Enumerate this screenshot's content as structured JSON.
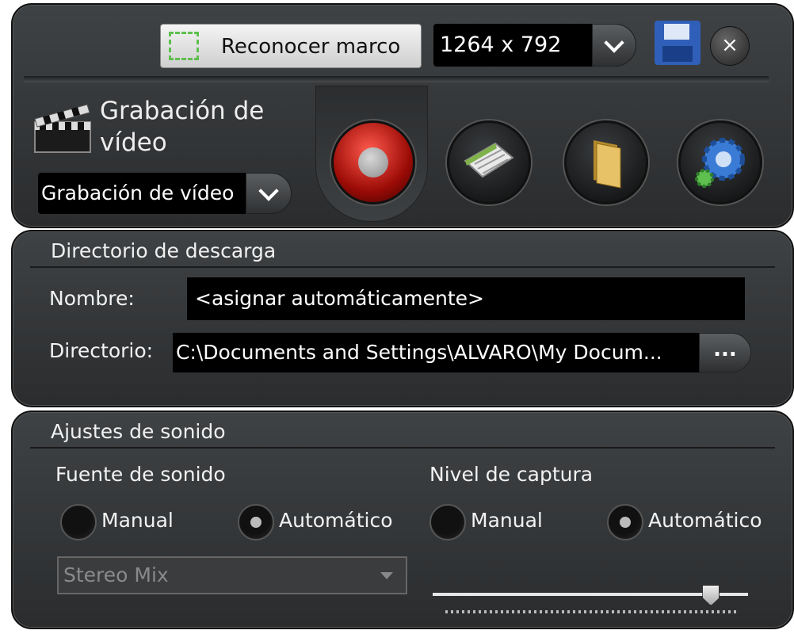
{
  "toolbar": {
    "frame_button_label": "Reconocer marco",
    "resolution_value": "1264 x 792",
    "close_label": "×"
  },
  "mode": {
    "title": "Grabación de vídeo",
    "selected": "Grabación de vídeo"
  },
  "download_dir": {
    "section_title": "Directorio de descarga",
    "name_label": "Nombre:",
    "name_value": "<asignar automáticamente>",
    "dir_label": "Directorio:",
    "dir_value": "C:\\Documents and Settings\\ALVARO\\My Docum...",
    "browse_label": "..."
  },
  "sound": {
    "section_title": "Ajustes de sonido",
    "source_label": "Fuente de sonido",
    "source_manual": "Manual",
    "source_auto": "Automático",
    "source_selected": "Automático",
    "device_value": "Stereo Mix",
    "capture_label": "Nivel de captura",
    "capture_manual": "Manual",
    "capture_auto": "Automático",
    "capture_selected": "Automático",
    "capture_level": 0.88
  },
  "colors": {
    "record_red": "#c4100a",
    "accent_green": "#5fbf4f",
    "save_blue": "#2f5fb8"
  },
  "icons": {
    "frame": "dashed-frame-icon",
    "save": "floppy-disk-icon",
    "close": "close-icon",
    "mode": "clapperboard-icon",
    "record": "record-icon",
    "schedule": "scheduler-icon",
    "folder": "folder-icon",
    "settings": "gear-icon"
  }
}
